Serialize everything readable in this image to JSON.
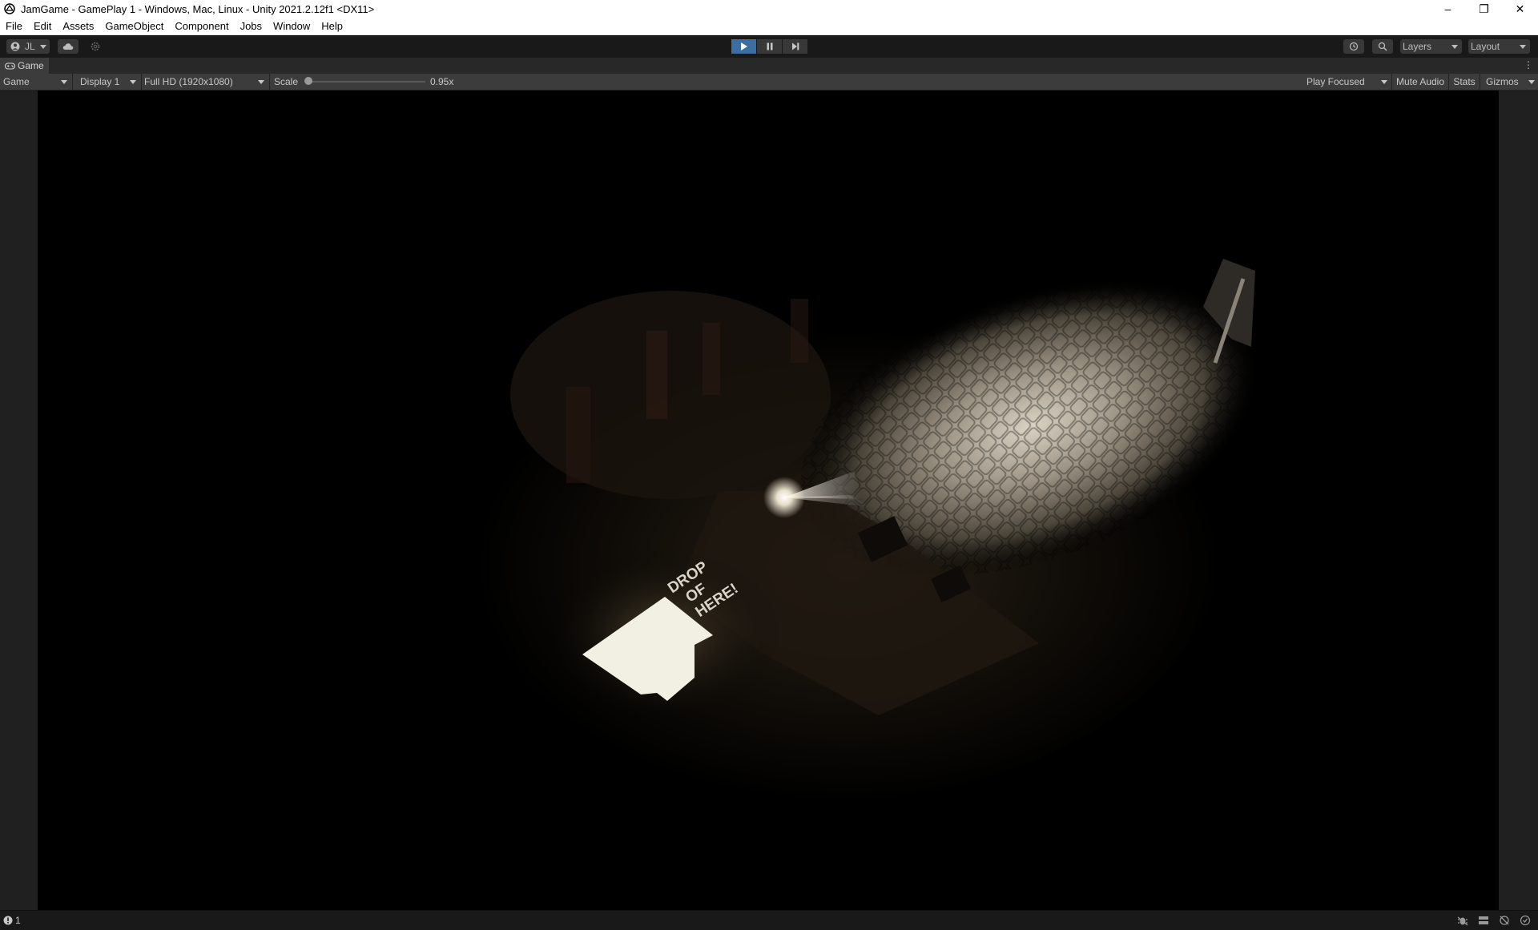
{
  "window": {
    "title": "JamGame - GamePlay 1 - Windows, Mac, Linux - Unity 2021.2.12f1 <DX11>",
    "minimize": "–",
    "restore": "❐",
    "close": "✕"
  },
  "menu": [
    "File",
    "Edit",
    "Assets",
    "GameObject",
    "Component",
    "Jobs",
    "Window",
    "Help"
  ],
  "toolbar": {
    "account": "JL",
    "layers": "Layers",
    "layout": "Layout"
  },
  "game_tab": {
    "label": "Game"
  },
  "game_toolbar": {
    "view_mode": "Game",
    "display": "Display 1",
    "resolution": "Full HD (1920x1080)",
    "scale_label": "Scale",
    "scale_value": "0.95x",
    "scale_fraction": 0.0,
    "play_focused": "Play Focused",
    "mute_audio": "Mute Audio",
    "stats": "Stats",
    "gizmos": "Gizmos"
  },
  "scene": {
    "sign_text": [
      "DROP",
      "OF",
      "HERE!"
    ]
  },
  "status": {
    "count": "1"
  },
  "colors": {
    "play_active": "#3d6ea1",
    "editor_bg": "#191919",
    "panel_bg": "#3c3c3c"
  }
}
